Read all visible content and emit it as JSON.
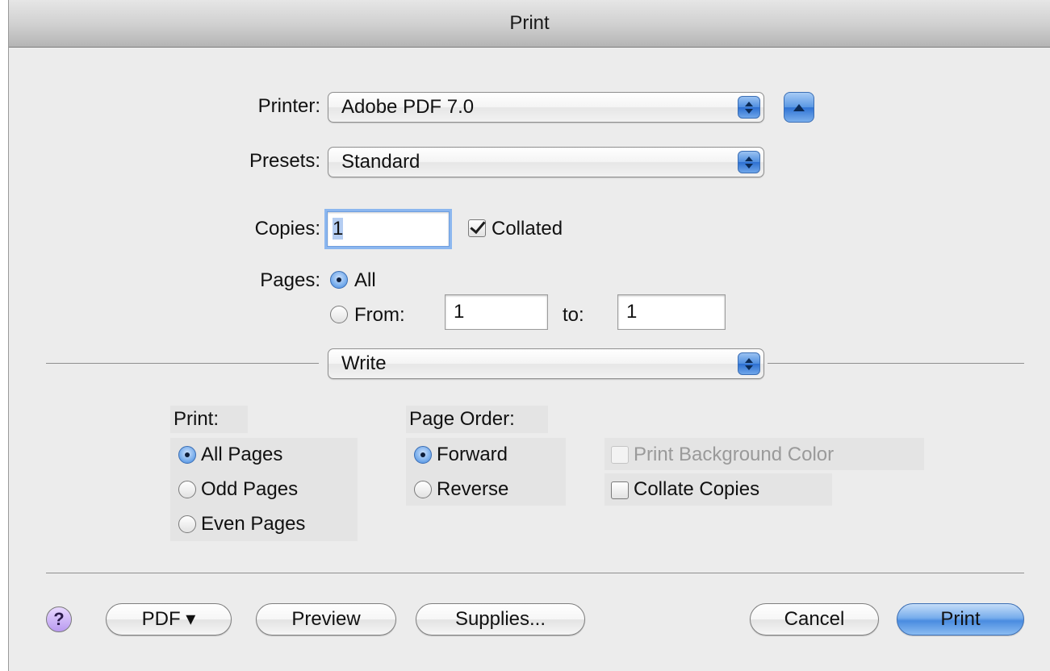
{
  "window": {
    "title": "Print"
  },
  "printer": {
    "label": "Printer:",
    "value": "Adobe PDF 7.0"
  },
  "presets": {
    "label": "Presets:",
    "value": "Standard"
  },
  "copies": {
    "label": "Copies:",
    "value": "1",
    "collated_label": "Collated",
    "collated_checked": true
  },
  "pages": {
    "label": "Pages:",
    "all_label": "All",
    "from_label": "From:",
    "from_value": "1",
    "to_label": "to:",
    "to_value": "1",
    "selected": "All"
  },
  "panel_menu": {
    "value": "Write"
  },
  "print_group": {
    "heading": "Print:",
    "options": [
      "All Pages",
      "Odd Pages",
      "Even Pages"
    ],
    "selected": "All Pages"
  },
  "page_order": {
    "heading": "Page Order:",
    "options": [
      "Forward",
      "Reverse"
    ],
    "selected": "Forward"
  },
  "checkboxes": {
    "print_background_label": "Print Background Color",
    "print_background_enabled": false,
    "collate_copies_label": "Collate Copies",
    "collate_copies_checked": false
  },
  "buttons": {
    "help": "?",
    "pdf": "PDF ▾",
    "preview": "Preview",
    "supplies": "Supplies...",
    "cancel": "Cancel",
    "print": "Print"
  },
  "icons": {
    "disclosure": "disclosure-up-icon",
    "popup_arrows": "popup-arrows-icon",
    "help": "help-icon"
  },
  "colors": {
    "accent": "#4a8ce0",
    "background": "#ececec"
  }
}
